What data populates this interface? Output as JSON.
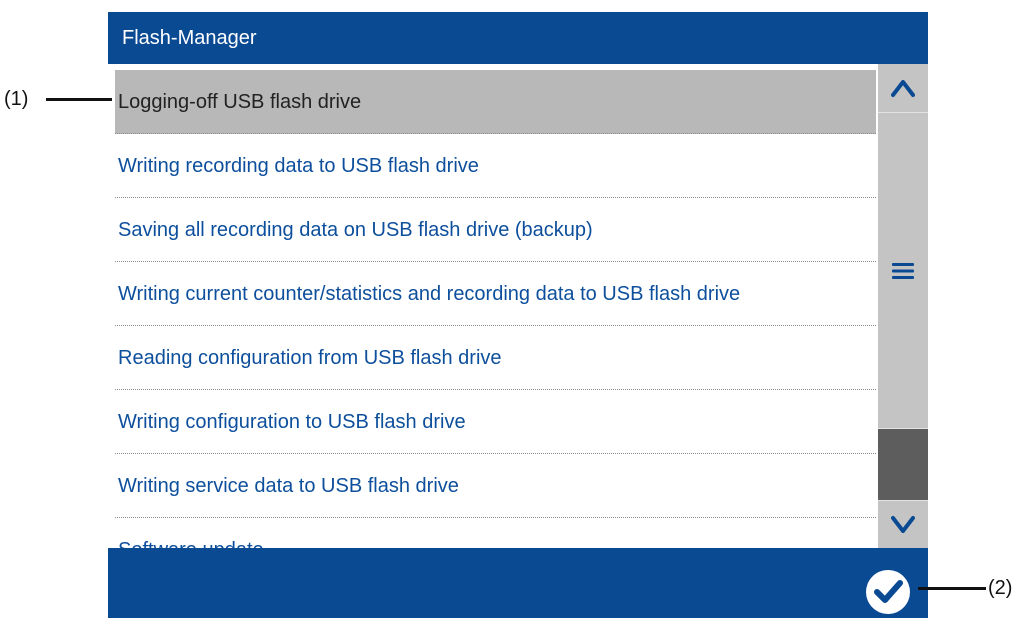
{
  "header": {
    "title": "Flash-Manager"
  },
  "list": {
    "items": [
      {
        "label": "Logging-off USB flash drive",
        "selected": true
      },
      {
        "label": "Writing recording data to USB flash drive",
        "selected": false
      },
      {
        "label": "Saving all recording data on USB flash drive (backup)",
        "selected": false
      },
      {
        "label": "Writing current counter/statistics and recording data to USB flash drive",
        "selected": false
      },
      {
        "label": "Reading configuration from USB flash drive",
        "selected": false
      },
      {
        "label": "Writing configuration to USB flash drive",
        "selected": false
      },
      {
        "label": "Writing service data to USB flash drive",
        "selected": false
      },
      {
        "label": "Software update",
        "selected": false
      }
    ]
  },
  "scrollbar": {
    "up_icon": "chevron-up-icon",
    "menu_icon": "menu-icon",
    "down_icon": "chevron-down-icon"
  },
  "footer": {
    "confirm_icon": "check-circle-icon"
  },
  "annotations": {
    "callout_1": "(1)",
    "callout_2": "(2)"
  },
  "colors": {
    "primary_blue": "#0a4a93",
    "link_blue": "#0d4f9c",
    "selected_gray": "#b8b8b8",
    "scrollbar_gray": "#c4c4c4",
    "thumb_gray": "#5d5d5d"
  }
}
